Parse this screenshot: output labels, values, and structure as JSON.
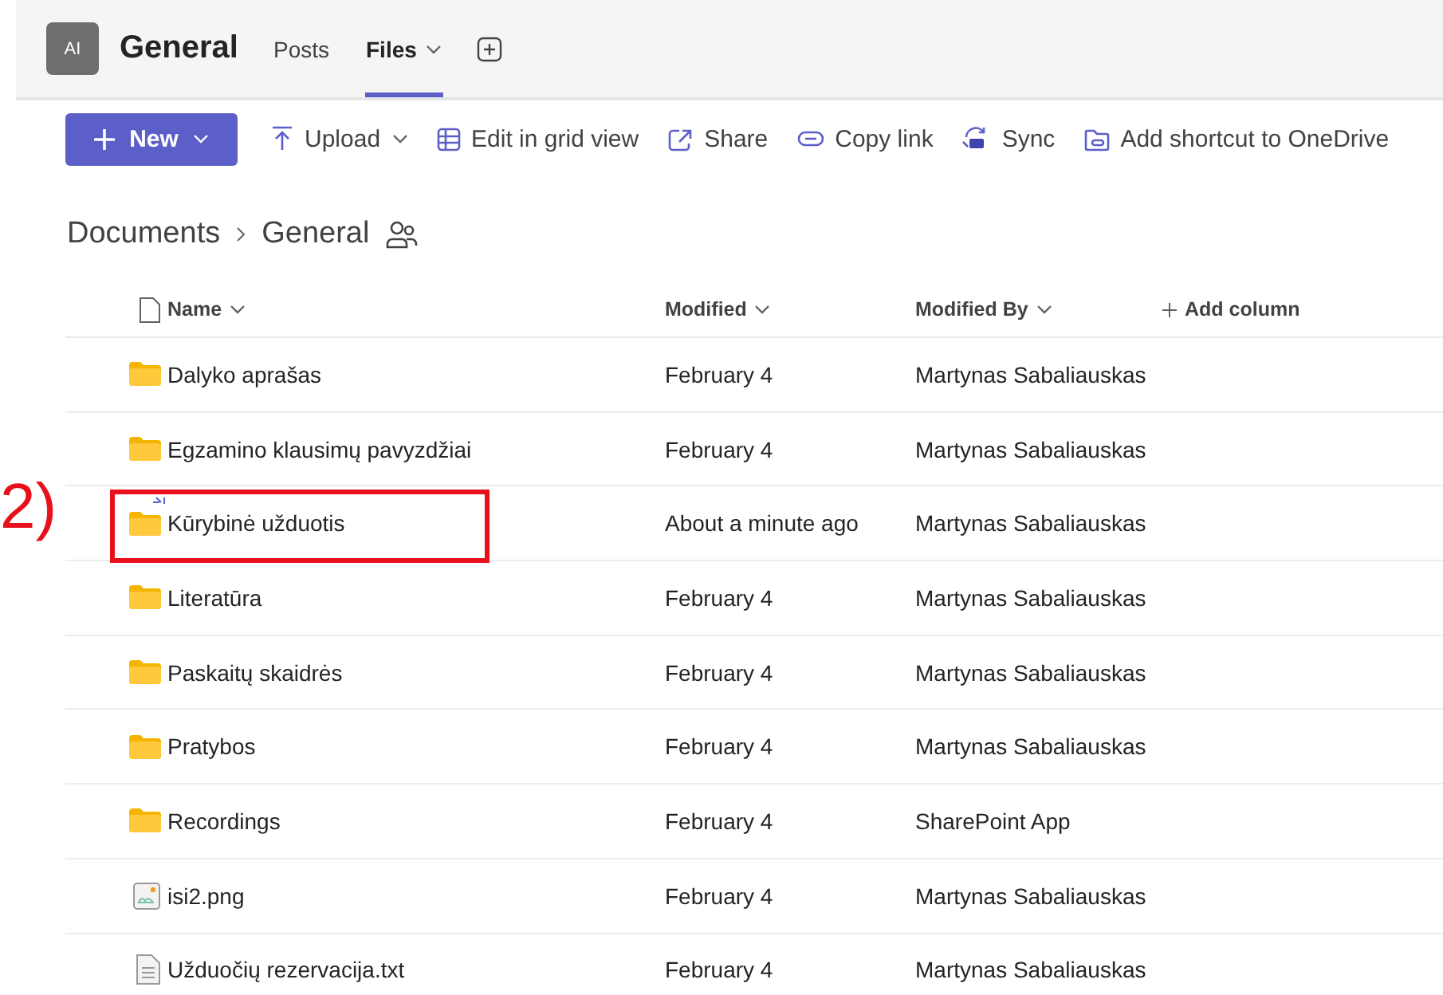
{
  "header": {
    "avatar": "AI",
    "title": "General",
    "tabs": [
      {
        "label": "Posts",
        "selected": false,
        "dropdown": false
      },
      {
        "label": "Files",
        "selected": true,
        "dropdown": true
      }
    ]
  },
  "toolbar": {
    "new_button": "New",
    "actions": [
      {
        "kind": "upload",
        "label": "Upload",
        "dropdown": true
      },
      {
        "kind": "grid",
        "label": "Edit in grid view",
        "dropdown": false
      },
      {
        "kind": "share",
        "label": "Share",
        "dropdown": false
      },
      {
        "kind": "link",
        "label": "Copy link",
        "dropdown": false
      },
      {
        "kind": "sync",
        "label": "Sync",
        "dropdown": false
      },
      {
        "kind": "shortcut",
        "label": "Add shortcut to OneDrive",
        "dropdown": false
      }
    ]
  },
  "breadcrumb": [
    "Documents",
    "General"
  ],
  "table": {
    "columns": [
      "Name",
      "Modified",
      "Modified By"
    ],
    "add_column": "Add column",
    "rows": [
      {
        "kind": "folder",
        "name": "Dalyko aprašas",
        "modified": "February 4",
        "modified_by": "Martynas Sabaliauskas",
        "new": false,
        "highlighted": false
      },
      {
        "kind": "folder",
        "name": "Egzamino klausimų pavyzdžiai",
        "modified": "February 4",
        "modified_by": "Martynas Sabaliauskas",
        "new": false,
        "highlighted": false
      },
      {
        "kind": "folder",
        "name": "Kūrybinė užduotis",
        "modified": "About a minute ago",
        "modified_by": "Martynas Sabaliauskas",
        "new": true,
        "highlighted": true
      },
      {
        "kind": "folder",
        "name": "Literatūra",
        "modified": "February 4",
        "modified_by": "Martynas Sabaliauskas",
        "new": false,
        "highlighted": false
      },
      {
        "kind": "folder",
        "name": "Paskaitų skaidrės",
        "modified": "February 4",
        "modified_by": "Martynas Sabaliauskas",
        "new": false,
        "highlighted": false
      },
      {
        "kind": "folder",
        "name": "Pratybos",
        "modified": "February 4",
        "modified_by": "Martynas Sabaliauskas",
        "new": false,
        "highlighted": false
      },
      {
        "kind": "folder",
        "name": "Recordings",
        "modified": "February 4",
        "modified_by": "SharePoint App",
        "new": false,
        "highlighted": false
      },
      {
        "kind": "image",
        "name": "isi2.png",
        "modified": "February 4",
        "modified_by": "Martynas Sabaliauskas",
        "new": false,
        "highlighted": false
      },
      {
        "kind": "text",
        "name": "Užduočių rezervacija.txt",
        "modified": "February 4",
        "modified_by": "Martynas Sabaliauskas",
        "new": false,
        "highlighted": false
      }
    ]
  },
  "annotation": {
    "label": "2)"
  }
}
